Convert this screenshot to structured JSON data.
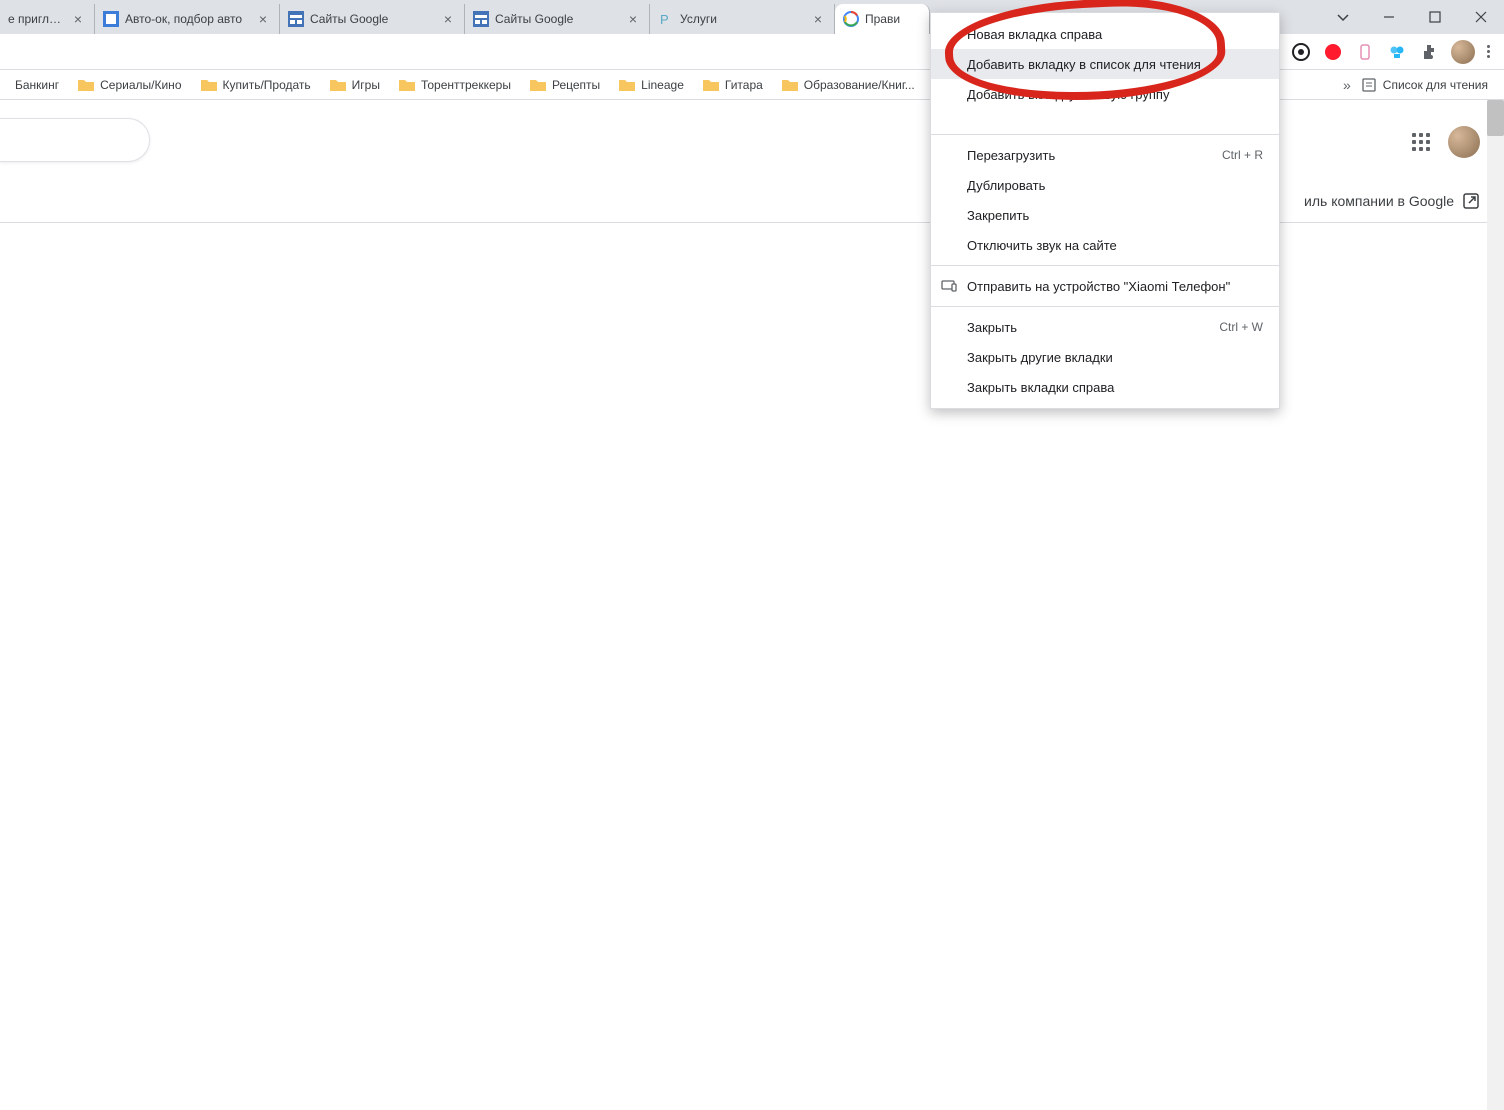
{
  "tabs": [
    {
      "title": "е приглаше",
      "icon": "generic"
    },
    {
      "title": "Авто-ок, подбор авто",
      "icon": "site-blue"
    },
    {
      "title": "Сайты Google",
      "icon": "google-sites"
    },
    {
      "title": "Сайты Google",
      "icon": "google-sites"
    },
    {
      "title": "Услуги",
      "icon": "site-p"
    },
    {
      "title": "Прави",
      "icon": "google",
      "active": true
    }
  ],
  "bookmarks": [
    "Банкинг",
    "Сериалы/Кино",
    "Купить/Продать",
    "Игры",
    "Торенттреккеры",
    "Рецепты",
    "Lineage",
    "Гитара",
    "Образование/Книг..."
  ],
  "bookmarks_overflow_label": "»",
  "reading_list_label": "Список для чтения",
  "context_menu": {
    "items": [
      {
        "label": "Новая вкладка справа",
        "hover": false
      },
      {
        "label": "Добавить вкладку в список для чтения",
        "hover": true
      },
      {
        "label": "Добавить вкладку в новую группу",
        "hover": false
      },
      {
        "label": "",
        "hidden_partial": true
      }
    ],
    "group2": [
      {
        "label": "Перезагрузить",
        "shortcut": "Ctrl + R"
      },
      {
        "label": "Дублировать"
      },
      {
        "label": "Закрепить"
      },
      {
        "label": "Отключить звук на сайте"
      }
    ],
    "group3": [
      {
        "label": "Отправить на устройство \"Xiaomi Телефон\"",
        "icon": "device"
      }
    ],
    "group4": [
      {
        "label": "Закрыть",
        "shortcut": "Ctrl + W"
      },
      {
        "label": "Закрыть другие вкладки"
      },
      {
        "label": "Закрыть вкладки справа"
      }
    ]
  },
  "page": {
    "company_profile_label": "иль компании в Google"
  },
  "extensions": [
    "ext-dark",
    "ext-opera",
    "ext-pink",
    "ext-qq",
    "ext-puzzle"
  ]
}
